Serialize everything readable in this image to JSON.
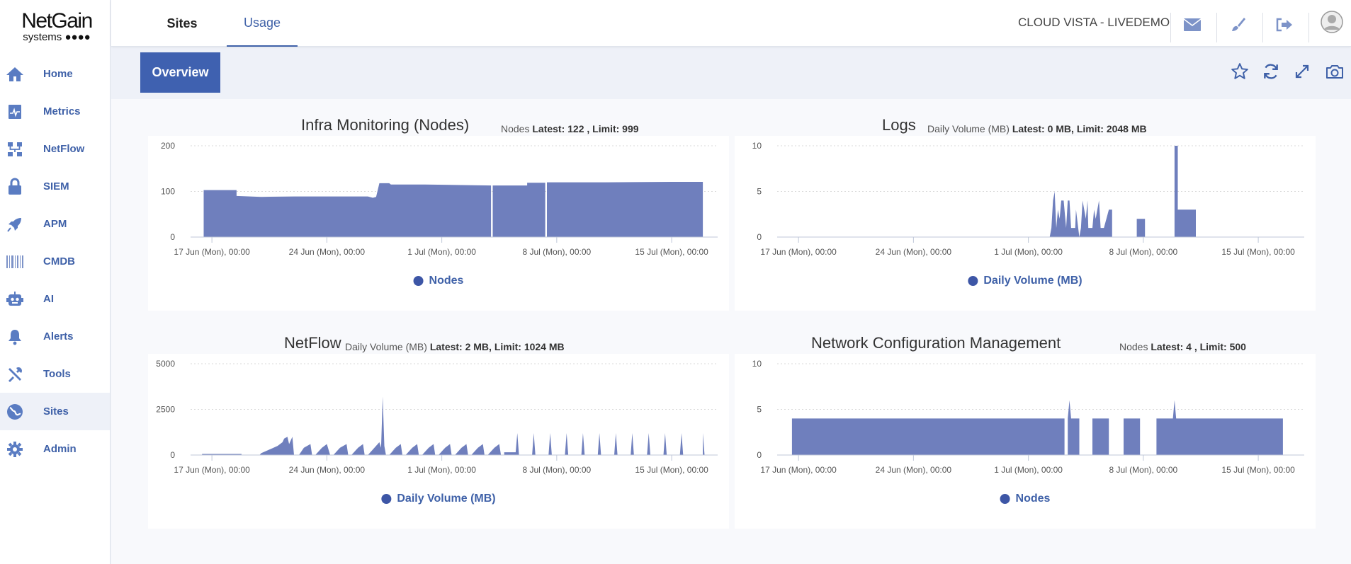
{
  "app": {
    "logo_line1": "NetGain",
    "logo_line2": "systems",
    "org_label": "CLOUD VISTA - LIVEDEMO",
    "accent_color": "#3f61a8",
    "series_color": "#6f7fbd"
  },
  "tabs": [
    {
      "label": "Sites",
      "active": false
    },
    {
      "label": "Usage",
      "active": true
    }
  ],
  "sidebar": {
    "items": [
      {
        "label": "Home",
        "icon": "home-icon"
      },
      {
        "label": "Metrics",
        "icon": "metrics-icon"
      },
      {
        "label": "NetFlow",
        "icon": "netflow-icon"
      },
      {
        "label": "SIEM",
        "icon": "lock-icon"
      },
      {
        "label": "APM",
        "icon": "rocket-icon"
      },
      {
        "label": "CMDB",
        "icon": "barcode-icon"
      },
      {
        "label": "AI",
        "icon": "robot-icon"
      },
      {
        "label": "Alerts",
        "icon": "bell-icon"
      },
      {
        "label": "Tools",
        "icon": "tools-icon"
      },
      {
        "label": "Sites",
        "icon": "globe-icon",
        "active": true
      },
      {
        "label": "Admin",
        "icon": "gear-icon"
      }
    ]
  },
  "top_icons": [
    "mail-icon",
    "brush-icon",
    "logout-icon",
    "user-avatar-icon"
  ],
  "overview_label": "Overview",
  "right_icons": [
    "star-icon",
    "refresh-icon",
    "expand-icon",
    "camera-icon"
  ],
  "panels": [
    {
      "title": "Infra Monitoring (Nodes)",
      "sub_metric": "Nodes",
      "sub_latest": "Latest: 122 , Limit: 999",
      "legend": "Nodes"
    },
    {
      "title": "Logs",
      "sub_metric": "Daily Volume (MB)",
      "sub_latest": "Latest: 0 MB, Limit: 2048 MB",
      "legend": "Daily Volume (MB)"
    },
    {
      "title": "NetFlow",
      "sub_metric": "Daily Volume (MB)",
      "sub_latest": "Latest: 2 MB, Limit: 1024 MB",
      "legend": "Daily Volume (MB)"
    },
    {
      "title": "Network Configuration Management",
      "sub_metric": "Nodes",
      "sub_latest": "Latest: 4 , Limit: 500",
      "legend": "Nodes"
    }
  ],
  "chart_data": [
    {
      "type": "area",
      "title": "Infra Monitoring (Nodes)",
      "x_ticks": [
        "17 Jun (Mon), 00:00",
        "24 Jun (Mon), 00:00",
        "1 Jul (Mon), 00:00",
        "8 Jul (Mon), 00:00",
        "15 Jul (Mon), 00:00"
      ],
      "x_range_days": [
        -1.3,
        30.8
      ],
      "ylim": [
        0,
        200
      ],
      "y_ticks": [
        0,
        100,
        200
      ],
      "series": [
        {
          "name": "Nodes",
          "points": [
            [
              -0.5,
              0
            ],
            [
              -0.5,
              103
            ],
            [
              1.5,
              103
            ],
            [
              1.5,
              90
            ],
            [
              3,
              88
            ],
            [
              5,
              89
            ],
            [
              9,
              89
            ],
            [
              9.5,
              89
            ],
            [
              9.8,
              86
            ],
            [
              10,
              88
            ],
            [
              10.2,
              118
            ],
            [
              10.8,
              118
            ],
            [
              10.9,
              115
            ],
            [
              13,
              115
            ],
            [
              17,
              113
            ],
            [
              17,
              0
            ],
            [
              17.1,
              0
            ],
            [
              17.1,
              113
            ],
            [
              19.2,
              113
            ],
            [
              19.2,
              119
            ],
            [
              20.3,
              119
            ],
            [
              20.3,
              0
            ],
            [
              20.4,
              0
            ],
            [
              20.4,
              120
            ],
            [
              24,
              120
            ],
            [
              28,
              121
            ],
            [
              29.9,
              121
            ],
            [
              29.9,
              0
            ]
          ]
        }
      ]
    },
    {
      "type": "area",
      "title": "Logs",
      "x_ticks": [
        "17 Jun (Mon), 00:00",
        "24 Jun (Mon), 00:00",
        "1 Jul (Mon), 00:00",
        "8 Jul (Mon), 00:00",
        "15 Jul (Mon), 00:00"
      ],
      "x_range_days": [
        -1.3,
        30.8
      ],
      "ylim": [
        0,
        10
      ],
      "y_ticks": [
        0,
        5,
        10
      ],
      "series": [
        {
          "name": "Daily Volume (MB)",
          "points": [
            [
              -1,
              0
            ],
            [
              15.3,
              0
            ],
            [
              15.4,
              1
            ],
            [
              15.5,
              4
            ],
            [
              15.6,
              5
            ],
            [
              15.7,
              1
            ],
            [
              15.8,
              3
            ],
            [
              15.9,
              2
            ],
            [
              16.0,
              4
            ],
            [
              16.15,
              4
            ],
            [
              16.3,
              1
            ],
            [
              16.4,
              4
            ],
            [
              16.5,
              4
            ],
            [
              16.6,
              1
            ],
            [
              16.85,
              1
            ],
            [
              16.9,
              3
            ],
            [
              17.1,
              0
            ],
            [
              17.2,
              1
            ],
            [
              17.3,
              4
            ],
            [
              17.4,
              3
            ],
            [
              17.5,
              2
            ],
            [
              17.6,
              4
            ],
            [
              17.65,
              1
            ],
            [
              17.9,
              1
            ],
            [
              18.0,
              3
            ],
            [
              18.1,
              2
            ],
            [
              18.3,
              4
            ],
            [
              18.4,
              1
            ],
            [
              18.6,
              1
            ],
            [
              18.75,
              2
            ],
            [
              18.9,
              3
            ],
            [
              19.1,
              3
            ],
            [
              19.1,
              0
            ],
            [
              20.6,
              0
            ],
            [
              20.6,
              2
            ],
            [
              21.1,
              2
            ],
            [
              21.1,
              0
            ],
            [
              22.9,
              0
            ],
            [
              22.9,
              10
            ],
            [
              23.1,
              10
            ],
            [
              23.1,
              3
            ],
            [
              24.2,
              3
            ],
            [
              24.2,
              0
            ],
            [
              30.5,
              0
            ]
          ]
        }
      ]
    },
    {
      "type": "area",
      "title": "NetFlow",
      "x_ticks": [
        "17 Jun (Mon), 00:00",
        "24 Jun (Mon), 00:00",
        "1 Jul (Mon), 00:00",
        "8 Jul (Mon), 00:00",
        "15 Jul (Mon), 00:00"
      ],
      "x_range_days": [
        -1.3,
        30.8
      ],
      "ylim": [
        0,
        5000
      ],
      "y_ticks": [
        0,
        2500,
        5000
      ],
      "series": [
        {
          "name": "Daily Volume (MB)",
          "points": [
            [
              -0.6,
              0
            ],
            [
              -0.6,
              60
            ],
            [
              1.8,
              60
            ],
            [
              1.8,
              0
            ],
            [
              2.9,
              0
            ],
            [
              3.0,
              100
            ],
            [
              3.5,
              300
            ],
            [
              4.0,
              500
            ],
            [
              4.3,
              700
            ],
            [
              4.4,
              900
            ],
            [
              4.6,
              1000
            ],
            [
              4.7,
              600
            ],
            [
              4.9,
              1000
            ],
            [
              5.0,
              0
            ],
            [
              5.3,
              0
            ],
            [
              5.6,
              400
            ],
            [
              6.0,
              600
            ],
            [
              6.1,
              0
            ],
            [
              6.3,
              0
            ],
            [
              6.7,
              400
            ],
            [
              7.0,
              600
            ],
            [
              7.2,
              0
            ],
            [
              7.4,
              0
            ],
            [
              7.8,
              400
            ],
            [
              8.2,
              600
            ],
            [
              8.3,
              0
            ],
            [
              8.5,
              0
            ],
            [
              8.9,
              400
            ],
            [
              9.2,
              600
            ],
            [
              9.3,
              0
            ],
            [
              9.5,
              0
            ],
            [
              10.2,
              700
            ],
            [
              10.3,
              400
            ],
            [
              10.4,
              3200
            ],
            [
              10.5,
              500
            ],
            [
              10.6,
              0
            ],
            [
              10.8,
              0
            ],
            [
              11.2,
              400
            ],
            [
              11.5,
              600
            ],
            [
              11.6,
              0
            ],
            [
              11.8,
              0
            ],
            [
              12.2,
              400
            ],
            [
              12.5,
              600
            ],
            [
              12.6,
              0
            ],
            [
              12.8,
              0
            ],
            [
              13.2,
              400
            ],
            [
              13.5,
              600
            ],
            [
              13.6,
              0
            ],
            [
              13.8,
              0
            ],
            [
              14.2,
              400
            ],
            [
              14.5,
              600
            ],
            [
              14.6,
              0
            ],
            [
              14.8,
              0
            ],
            [
              15.2,
              400
            ],
            [
              15.5,
              600
            ],
            [
              15.6,
              0
            ],
            [
              15.8,
              0
            ],
            [
              16.2,
              400
            ],
            [
              16.5,
              600
            ],
            [
              16.6,
              0
            ],
            [
              16.8,
              0
            ],
            [
              17.2,
              400
            ],
            [
              17.5,
              600
            ],
            [
              17.6,
              0
            ],
            [
              17.8,
              0
            ],
            [
              17.8,
              150
            ],
            [
              18.5,
              150
            ],
            [
              18.6,
              1200
            ],
            [
              18.7,
              0
            ],
            [
              19.5,
              0
            ],
            [
              19.6,
              1200
            ],
            [
              19.7,
              0
            ],
            [
              20.5,
              0
            ],
            [
              20.6,
              1200
            ],
            [
              20.7,
              0
            ],
            [
              21.5,
              0
            ],
            [
              21.6,
              1200
            ],
            [
              21.7,
              0
            ],
            [
              22.5,
              0
            ],
            [
              22.6,
              1200
            ],
            [
              22.7,
              0
            ],
            [
              23.5,
              0
            ],
            [
              23.6,
              1200
            ],
            [
              23.7,
              0
            ],
            [
              24.5,
              0
            ],
            [
              24.6,
              1200
            ],
            [
              24.7,
              0
            ],
            [
              25.5,
              0
            ],
            [
              25.6,
              1200
            ],
            [
              25.7,
              0
            ],
            [
              26.5,
              0
            ],
            [
              26.6,
              1200
            ],
            [
              26.7,
              0
            ],
            [
              27.5,
              0
            ],
            [
              27.6,
              1200
            ],
            [
              27.7,
              0
            ],
            [
              28.5,
              0
            ],
            [
              28.6,
              1200
            ],
            [
              28.7,
              0
            ],
            [
              29.9,
              0
            ],
            [
              29.9,
              1200
            ],
            [
              30.0,
              0
            ]
          ]
        }
      ]
    },
    {
      "type": "area",
      "title": "Network Configuration Management",
      "x_ticks": [
        "17 Jun (Mon), 00:00",
        "24 Jun (Mon), 00:00",
        "1 Jul (Mon), 00:00",
        "8 Jul (Mon), 00:00",
        "15 Jul (Mon), 00:00"
      ],
      "x_range_days": [
        -1.3,
        30.8
      ],
      "ylim": [
        0,
        10
      ],
      "y_ticks": [
        0,
        5,
        10
      ],
      "series": [
        {
          "name": "Nodes",
          "points": [
            [
              -0.4,
              0
            ],
            [
              -0.4,
              4
            ],
            [
              16.2,
              4
            ],
            [
              16.2,
              0
            ],
            [
              16.4,
              0
            ],
            [
              16.4,
              4
            ],
            [
              16.5,
              6
            ],
            [
              16.6,
              4
            ],
            [
              17.1,
              4
            ],
            [
              17.1,
              0
            ],
            [
              17.9,
              0
            ],
            [
              17.9,
              4
            ],
            [
              18.9,
              4
            ],
            [
              18.9,
              0
            ],
            [
              19.8,
              0
            ],
            [
              19.8,
              4
            ],
            [
              20.8,
              4
            ],
            [
              20.8,
              0
            ],
            [
              21.8,
              0
            ],
            [
              21.8,
              4
            ],
            [
              22.8,
              4
            ],
            [
              22.9,
              6
            ],
            [
              23.0,
              4
            ],
            [
              29.5,
              4
            ],
            [
              29.5,
              0
            ]
          ]
        }
      ]
    }
  ]
}
